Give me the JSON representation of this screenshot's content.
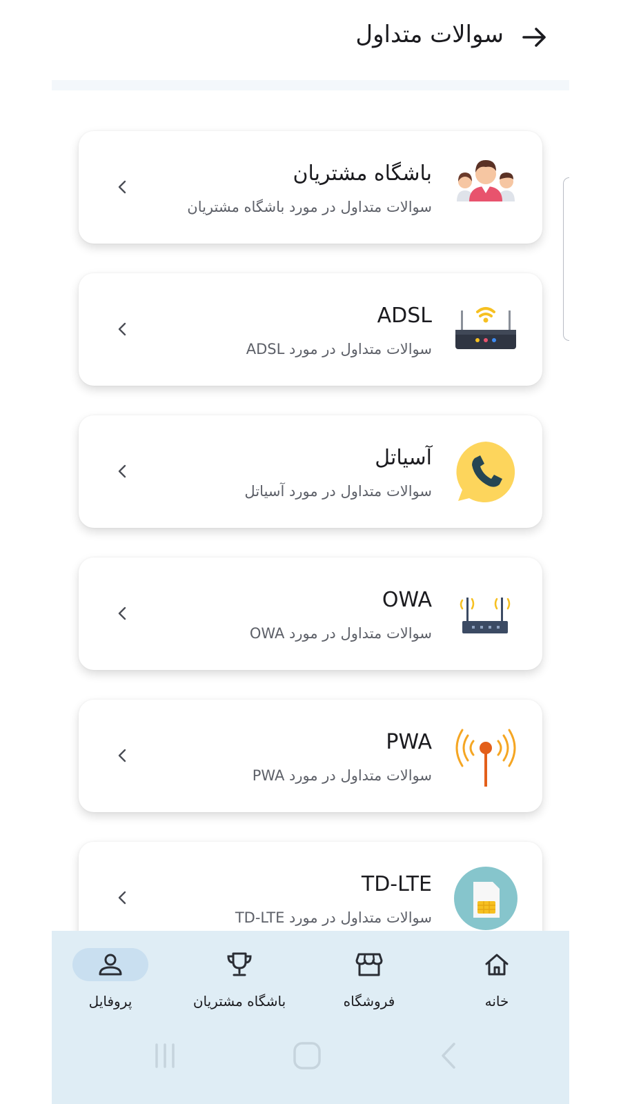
{
  "header": {
    "title": "سوالات متداول",
    "back_icon": "arrow-right-icon"
  },
  "faq_items": [
    {
      "title": "باشگاه مشتریان",
      "subtitle": "سوالات متداول در مورد باشگاه مشتریان",
      "icon": "customers-group-icon"
    },
    {
      "title": "ADSL",
      "subtitle": "سوالات متداول در مورد ADSL",
      "icon": "wifi-router-icon"
    },
    {
      "title": "آسیاتل",
      "subtitle": "سوالات متداول در مورد آسیاتل",
      "icon": "phone-chat-icon"
    },
    {
      "title": "OWA",
      "subtitle": "سوالات متداول در مورد OWA",
      "icon": "router-antenna-icon"
    },
    {
      "title": "PWA",
      "subtitle": "سوالات متداول در مورد PWA",
      "icon": "signal-tower-icon"
    },
    {
      "title": "TD-LTE",
      "subtitle": "سوالات متداول در مورد TD-LTE",
      "icon": "sim-card-icon"
    }
  ],
  "bottom_nav": {
    "items": [
      {
        "label": "خانه",
        "icon": "home-icon",
        "active": false
      },
      {
        "label": "فروشگاه",
        "icon": "store-icon",
        "active": false
      },
      {
        "label": "باشگاه مشتریان",
        "icon": "trophy-icon",
        "active": false
      },
      {
        "label": "پروفایل",
        "icon": "user-icon",
        "active": true
      }
    ]
  },
  "colors": {
    "nav_background": "#dfedf5",
    "active_pill": "#c9dff0",
    "text_primary": "#1b1b1f",
    "text_secondary": "#5d6068"
  }
}
